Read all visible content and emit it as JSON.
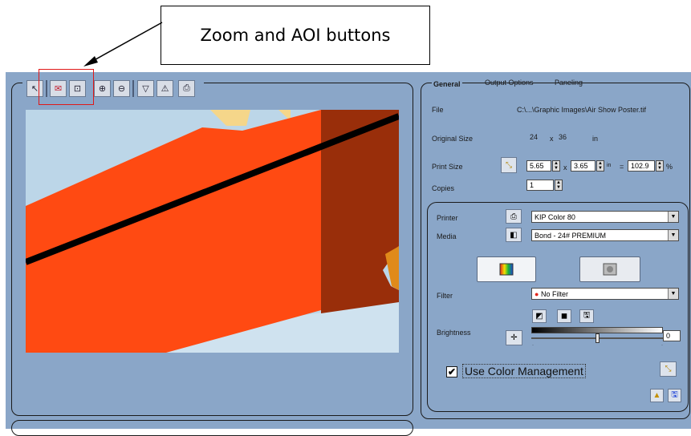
{
  "callout": {
    "text": "Zoom and AOI buttons"
  },
  "toolbar": {
    "buttons": [
      {
        "name": "select-tool",
        "icon": "pointer-icon",
        "glyph": "↖"
      },
      {
        "name": "aoi-tool",
        "icon": "aoi-icon",
        "glyph": "✉"
      },
      {
        "name": "zoom-window-tool",
        "icon": "zoom-window-icon",
        "glyph": "⊡"
      },
      {
        "name": "zoom-in-tool",
        "icon": "zoom-in-icon",
        "glyph": "⊕"
      },
      {
        "name": "zoom-out-tool",
        "icon": "zoom-out-icon",
        "glyph": "⊖"
      },
      {
        "name": "filter-tool",
        "icon": "funnel-icon",
        "glyph": "▽"
      },
      {
        "name": "warning-tool",
        "icon": "warning-icon",
        "glyph": "⚠"
      },
      {
        "name": "print-tool",
        "icon": "printer-icon",
        "glyph": "⎙"
      }
    ]
  },
  "tabs": {
    "general": "General",
    "output_options": "Output Options",
    "paneling": "Paneling"
  },
  "general": {
    "file_label": "File",
    "file_value": "C:\\...\\Graphic Images\\Air Show Poster.tif",
    "original_size_label": "Original Size",
    "original_w": "24",
    "original_x": "x",
    "original_h": "36",
    "original_unit": "in",
    "print_size_label": "Print Size",
    "print_w": "5.65",
    "print_x": "x",
    "print_h": "3.65",
    "print_unit": "in",
    "equals": "=",
    "print_pct": "102.9",
    "pct_sign": "%",
    "copies_label": "Copies",
    "copies_value": "1"
  },
  "printer": {
    "printer_label": "Printer",
    "printer_value": "KIP Color 80",
    "media_label": "Media",
    "media_value": "Bond - 24# PREMIUM",
    "filter_label": "Filter",
    "filter_value": "No Filter",
    "brightness_label": "Brightness",
    "brightness_value": "0",
    "brightness_level": 0.5,
    "use_color_mgmt_label": "Use Color Management",
    "use_color_mgmt_checked": true,
    "check_glyph": "✔"
  },
  "colors": {
    "accent_red": "#e01818",
    "app_bg": "#8aa6c8",
    "art_orange": "#ff4a12",
    "art_brown": "#992e0a"
  }
}
